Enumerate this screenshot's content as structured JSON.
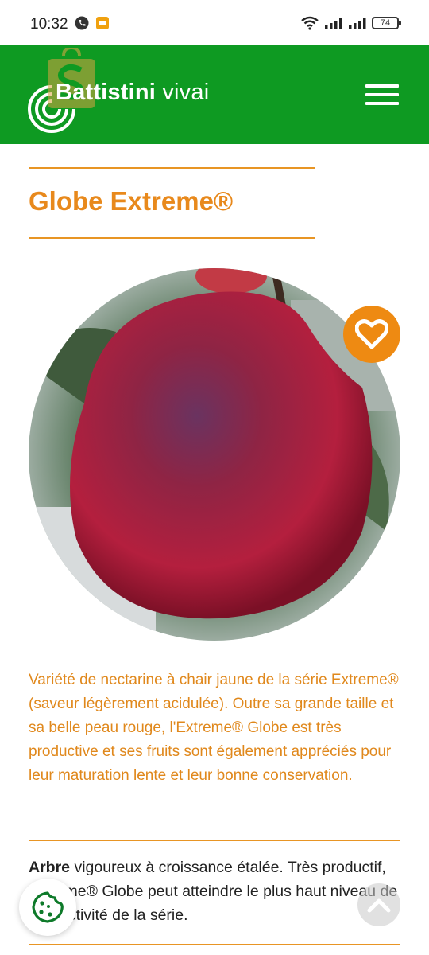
{
  "status_bar": {
    "time": "10:32",
    "battery": "74"
  },
  "header": {
    "brand_bold": "Battistini",
    "brand_light": "vivai",
    "brand_color": "#0e9a22"
  },
  "product": {
    "title": "Globe Extreme®",
    "description": "Variété de nectarine à chair jaune de la série Extreme® (saveur légèrement acidulée). Outre sa grande taille et sa belle peau rouge, l'Extreme® Globe est très productive et ses fruits sont également appréciés pour leur maturation lente et leur bonne conservation.",
    "tree_label": "Arbre",
    "tree_text": " vigoureux à croissance étalée. Très productif, Extreme® Globe peut atteindre le plus haut niveau de productivité de la série."
  },
  "colors": {
    "accent": "#e8891c",
    "favorite": "#ee8a12"
  },
  "icons": {
    "menu": "hamburger-icon",
    "favorite": "heart-icon",
    "cookie": "cookie-icon",
    "scroll_top": "chevron-up-icon"
  }
}
